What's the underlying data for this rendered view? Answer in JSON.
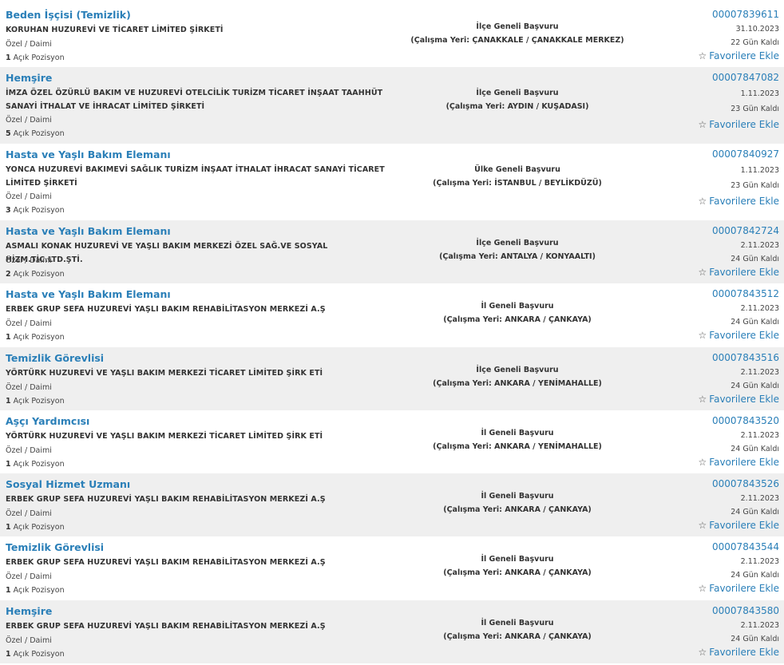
{
  "labels": {
    "position_suffix": "Açık Pozisyon",
    "workplace_prefix": "(Çalışma Yeri: ",
    "workplace_suffix": ")",
    "favorite": "Favorilere Ekle"
  },
  "icons": {
    "favorite": "star-outline-icon"
  },
  "colors": {
    "link": "#2a7fb8",
    "alt_row": "#efefef",
    "text": "#333333"
  },
  "listings": [
    {
      "title": "Beden İşçisi (Temizlik)",
      "company": "KORUHAN HUZUREVİ VE TİCARET LİMİTED ŞİRKETİ",
      "type": "Özel / Daimi",
      "count": "1",
      "scope": "İlçe Geneli Başvuru",
      "location": "ÇANAKKALE / ÇANAKKALE MERKEZ",
      "id": "00007839611",
      "date": "31.10.2023",
      "days": "22 Gün Kaldı"
    },
    {
      "title": "Hemşire",
      "company": "İMZA ÖZEL ÖZÜRLÜ BAKIM VE HUZUREVİ OTELCİLİK TURİZM TİCARET İNŞAAT TAAHHÜT SANAYİ İTHALAT VE İHRACAT LİMİTED ŞİRKETİ",
      "type": "Özel / Daimi",
      "count": "5",
      "scope": "İlçe Geneli Başvuru",
      "location": "AYDIN / KUŞADASI",
      "id": "00007847082",
      "date": "1.11.2023",
      "days": "23 Gün Kaldı"
    },
    {
      "title": "Hasta ve Yaşlı Bakım Elemanı",
      "company": "YONCA HUZUREVİ BAKIMEVİ SAĞLIK TURİZM İNŞAAT İTHALAT İHRACAT SANAYİ TİCARET LİMİTED ŞİRKETİ",
      "type": "Özel / Daimi",
      "count": "3",
      "scope": "Ülke Geneli Başvuru",
      "location": "İSTANBUL / BEYLİKDÜZÜ",
      "id": "00007840927",
      "date": "1.11.2023",
      "days": "23 Gün Kaldı"
    },
    {
      "title": "Hasta ve Yaşlı Bakım Elemanı",
      "company": "ASMALI KONAK HUZUREVİ VE YAŞLI BAKIM MERKEZİ ÖZEL SAĞ.VE SOSYAL HİZM.TİC.LTD.ŞTİ.",
      "type": "Özel / Daimi",
      "count": "2",
      "scope": "İlçe Geneli Başvuru",
      "location": "ANTALYA / KONYAALTI",
      "id": "00007842724",
      "date": "2.11.2023",
      "days": "24 Gün Kaldı"
    },
    {
      "title": "Hasta ve Yaşlı Bakım Elemanı",
      "company": "ERBEK GRUP SEFA HUZUREVİ YAŞLI BAKIM REHABİLİTASYON MERKEZİ A.Ş",
      "type": "Özel / Daimi",
      "count": "1",
      "scope": "İl Geneli Başvuru",
      "location": "ANKARA / ÇANKAYA",
      "id": "00007843512",
      "date": "2.11.2023",
      "days": "24 Gün Kaldı"
    },
    {
      "title": "Temizlik Görevlisi",
      "company": "YÖRTÜRK HUZUREVİ VE YAŞLI BAKIM MERKEZİ TİCARET LİMİTED ŞİRK ETİ",
      "type": "Özel / Daimi",
      "count": "1",
      "scope": "İlçe Geneli Başvuru",
      "location": "ANKARA / YENİMAHALLE",
      "id": "00007843516",
      "date": "2.11.2023",
      "days": "24 Gün Kaldı"
    },
    {
      "title": "Aşçı Yardımcısı",
      "company": "YÖRTÜRK HUZUREVİ VE YAŞLI BAKIM MERKEZİ TİCARET LİMİTED ŞİRK ETİ",
      "type": "Özel / Daimi",
      "count": "1",
      "scope": "İl Geneli Başvuru",
      "location": "ANKARA / YENİMAHALLE",
      "id": "00007843520",
      "date": "2.11.2023",
      "days": "24 Gün Kaldı"
    },
    {
      "title": "Sosyal Hizmet Uzmanı",
      "company": "ERBEK GRUP SEFA HUZUREVİ YAŞLI BAKIM REHABİLİTASYON MERKEZİ A.Ş",
      "type": "Özel / Daimi",
      "count": "1",
      "scope": "İl Geneli Başvuru",
      "location": "ANKARA / ÇANKAYA",
      "id": "00007843526",
      "date": "2.11.2023",
      "days": "24 Gün Kaldı"
    },
    {
      "title": "Temizlik Görevlisi",
      "company": "ERBEK GRUP SEFA HUZUREVİ YAŞLI BAKIM REHABİLİTASYON MERKEZİ A.Ş",
      "type": "Özel / Daimi",
      "count": "1",
      "scope": "İl Geneli Başvuru",
      "location": "ANKARA / ÇANKAYA",
      "id": "00007843544",
      "date": "2.11.2023",
      "days": "24 Gün Kaldı"
    },
    {
      "title": "Hemşire",
      "company": "ERBEK GRUP SEFA HUZUREVİ YAŞLI BAKIM REHABİLİTASYON MERKEZİ A.Ş",
      "type": "Özel / Daimi",
      "count": "1",
      "scope": "İl Geneli Başvuru",
      "location": "ANKARA / ÇANKAYA",
      "id": "00007843580",
      "date": "2.11.2023",
      "days": "24 Gün Kaldı"
    }
  ]
}
